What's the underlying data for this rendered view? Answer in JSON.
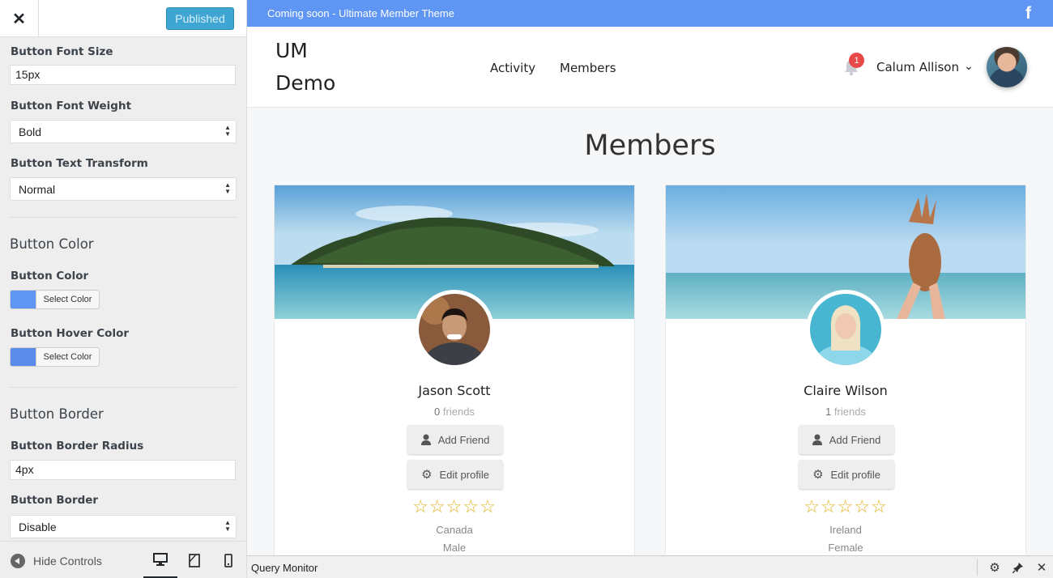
{
  "customizer": {
    "publish_label": "Published",
    "fields": {
      "font_size_label": "Button Font Size",
      "font_size_value": "15px",
      "font_weight_label": "Button Font Weight",
      "font_weight_value": "Bold",
      "text_transform_label": "Button Text Transform",
      "text_transform_value": "Normal",
      "color_section": "Button Color",
      "button_color_label": "Button Color",
      "button_color_swatch": "#5f96f3",
      "hover_color_label": "Button Hover Color",
      "hover_color_swatch": "#5b8be8",
      "select_color_label": "Select Color",
      "border_section": "Button Border",
      "border_radius_label": "Button Border Radius",
      "border_radius_value": "4px",
      "border_label": "Button Border",
      "border_value": "Disable"
    },
    "footer": {
      "hide_controls": "Hide Controls"
    }
  },
  "site": {
    "topbar_text": "Coming soon - Ultimate Member Theme",
    "logo": "UM Demo",
    "nav": [
      "Activity",
      "Members"
    ],
    "notifications_count": "1",
    "user_name": "Calum Allison",
    "page_title": "Members"
  },
  "members": [
    {
      "name": "Jason Scott",
      "friends_count": "0",
      "friends_label": "friends",
      "add_friend": "Add Friend",
      "edit_profile": "Edit profile",
      "rating": 0,
      "country": "Canada",
      "gender": "Male"
    },
    {
      "name": "Claire Wilson",
      "friends_count": "1",
      "friends_label": "friends",
      "add_friend": "Add Friend",
      "edit_profile": "Edit profile",
      "rating": 0,
      "country": "Ireland",
      "gender": "Female"
    }
  ],
  "query_monitor": {
    "title": "Query Monitor"
  },
  "colors": {
    "accent": "#5f96f3",
    "publish": "#3fa6d3",
    "star": "#e2b320",
    "badge": "#e94848"
  }
}
